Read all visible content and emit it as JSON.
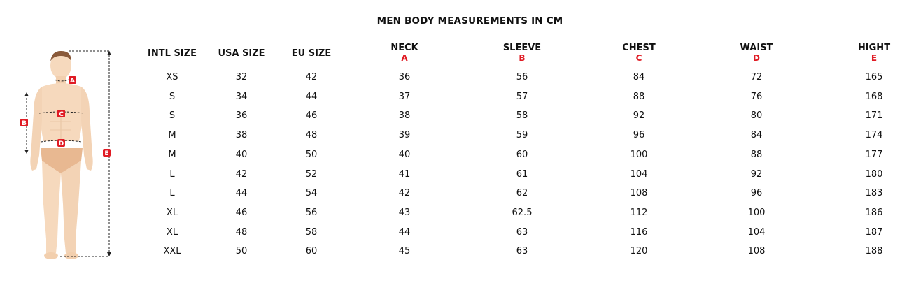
{
  "title": "MEN BODY MEASUREMENTS IN CM",
  "figure": {
    "labels": [
      "A",
      "B",
      "C",
      "D",
      "E"
    ],
    "label_color": "#e01b24",
    "skin_color": "#f6d9bd",
    "underwear_color": "#e8b891"
  },
  "table": {
    "columns": [
      {
        "label": "INTL SIZE",
        "code": ""
      },
      {
        "label": "USA SIZE",
        "code": ""
      },
      {
        "label": "EU SIZE",
        "code": ""
      },
      {
        "label": "NECK",
        "code": "A"
      },
      {
        "label": "SLEEVE",
        "code": "B"
      },
      {
        "label": "CHEST",
        "code": "C"
      },
      {
        "label": "WAIST",
        "code": "D"
      },
      {
        "label": "HIGHT",
        "code": "E"
      }
    ],
    "rows": [
      [
        "XS",
        "32",
        "42",
        "36",
        "56",
        "84",
        "72",
        "165"
      ],
      [
        "S",
        "34",
        "44",
        "37",
        "57",
        "88",
        "76",
        "168"
      ],
      [
        "S",
        "36",
        "46",
        "38",
        "58",
        "92",
        "80",
        "171"
      ],
      [
        "M",
        "38",
        "48",
        "39",
        "59",
        "96",
        "84",
        "174"
      ],
      [
        "M",
        "40",
        "50",
        "40",
        "60",
        "100",
        "88",
        "177"
      ],
      [
        "L",
        "42",
        "52",
        "41",
        "61",
        "104",
        "92",
        "180"
      ],
      [
        "L",
        "44",
        "54",
        "42",
        "62",
        "108",
        "96",
        "183"
      ],
      [
        "XL",
        "46",
        "56",
        "43",
        "62.5",
        "112",
        "100",
        "186"
      ],
      [
        "XL",
        "48",
        "58",
        "44",
        "63",
        "116",
        "104",
        "187"
      ],
      [
        "XXL",
        "50",
        "60",
        "45",
        "63",
        "120",
        "108",
        "188"
      ]
    ]
  }
}
